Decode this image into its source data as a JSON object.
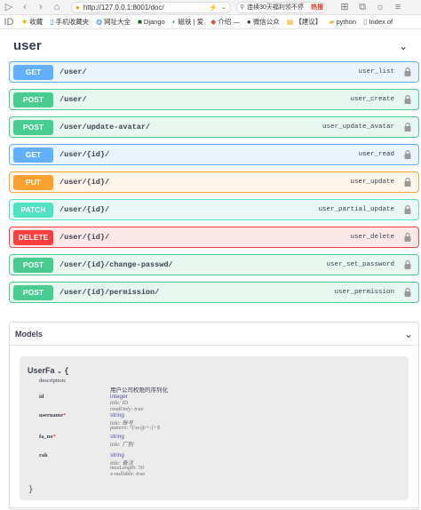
{
  "browser": {
    "url": "http://127.0.0.1:8001/doc/",
    "search_text": "连续30天福利领不停",
    "search_badge": "热搜"
  },
  "bookmarks": [
    {
      "label": "收藏",
      "icon": "star-icon"
    },
    {
      "label": "手机收藏夹",
      "icon": "phone-icon"
    },
    {
      "label": "网址大全",
      "icon": "globe-icon"
    },
    {
      "label": "Django",
      "icon": "django-icon"
    },
    {
      "label": "磁铁 | 爱",
      "icon": "magnet-icon"
    },
    {
      "label": "介绍 —",
      "icon": "info-icon"
    },
    {
      "label": "微信公众",
      "icon": "wechat-icon"
    },
    {
      "label": "【建议】",
      "icon": "doc-icon"
    },
    {
      "label": "python",
      "icon": "folder-icon"
    },
    {
      "label": "Index of",
      "icon": "page-icon"
    }
  ],
  "tag": {
    "title": "user"
  },
  "operations": [
    {
      "method": "GET",
      "path": "/user/",
      "operation_id": "user_list"
    },
    {
      "method": "POST",
      "path": "/user/",
      "operation_id": "user_create"
    },
    {
      "method": "POST",
      "path": "/user/update-avatar/",
      "operation_id": "user_update_avatar"
    },
    {
      "method": "GET",
      "path": "/user/{id}/",
      "operation_id": "user_read"
    },
    {
      "method": "PUT",
      "path": "/user/{id}/",
      "operation_id": "user_update"
    },
    {
      "method": "PATCH",
      "path": "/user/{id}/",
      "operation_id": "user_partial_update"
    },
    {
      "method": "DELETE",
      "path": "/user/{id}/",
      "operation_id": "user_delete"
    },
    {
      "method": "POST",
      "path": "/user/{id}/change-passwd/",
      "operation_id": "user_set_password"
    },
    {
      "method": "POST",
      "path": "/user/{id}/permission/",
      "operation_id": "user_permission"
    }
  ],
  "models": {
    "title": "Models",
    "model_name": "UserFa",
    "description_label": "description:",
    "description_value": "用户公司权限的序列化",
    "properties": [
      {
        "name": "id",
        "required": false,
        "type": "integer",
        "meta": [
          "title: ID",
          "readOnly: true"
        ]
      },
      {
        "name": "username",
        "required": true,
        "type": "string",
        "meta": [
          "title: 账号",
          "pattern: ^[\\w.@+-]+$"
        ]
      },
      {
        "name": "fa_no",
        "required": true,
        "type": "string",
        "meta": [
          "title: 厂别"
        ]
      },
      {
        "name": "rak",
        "required": false,
        "type": "string",
        "meta": [
          "title: 备注",
          "maxLength: 50",
          "x-nullable: true"
        ]
      }
    ]
  }
}
